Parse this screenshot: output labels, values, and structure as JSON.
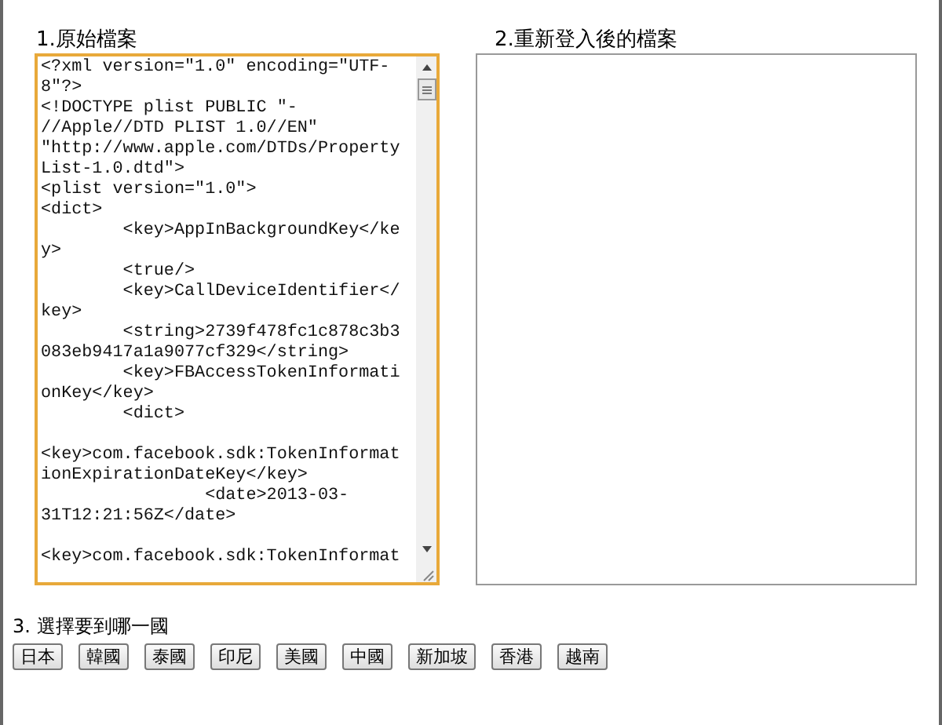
{
  "panels": [
    {
      "label": "1.原始檔案",
      "focused": true,
      "blocks": [
        [
          "<?xml version=\"1.0\" encoding=\"UTF-",
          "8\"?>",
          "<!DOCTYPE plist PUBLIC \"-",
          "//Apple//DTD PLIST 1.0//EN\"",
          "\"http://www.apple.com/DTDs/Property",
          "List-1.0.dtd\">",
          "<plist version=\"1.0\">",
          "<dict>",
          "        <key>AppInBackgroundKey</ke",
          "y>",
          "        <true/>",
          "        <key>CallDeviceIdentifier</",
          "key>",
          "        <string>2739f478fc1c878c3b3",
          "083eb9417a1a9077cf329</string>",
          "        <key>FBAccessTokenInformati",
          "onKey</key>",
          "        <dict>"
        ],
        [
          "<key>com.facebook.sdk:TokenInformat",
          "ionExpirationDateKey</key>",
          "                <date>2013-03-",
          "31T12:21:56Z</date>"
        ],
        [
          "<key>com.facebook.sdk:TokenInformat"
        ]
      ]
    },
    {
      "label": "2.重新登入後的檔案",
      "focused": false
    }
  ],
  "country_prompt": "3. 選擇要到哪一國",
  "countries": [
    "日本",
    "韓國",
    "泰國",
    "印尼",
    "美國",
    "中國",
    "新加坡",
    "香港",
    "越南"
  ]
}
